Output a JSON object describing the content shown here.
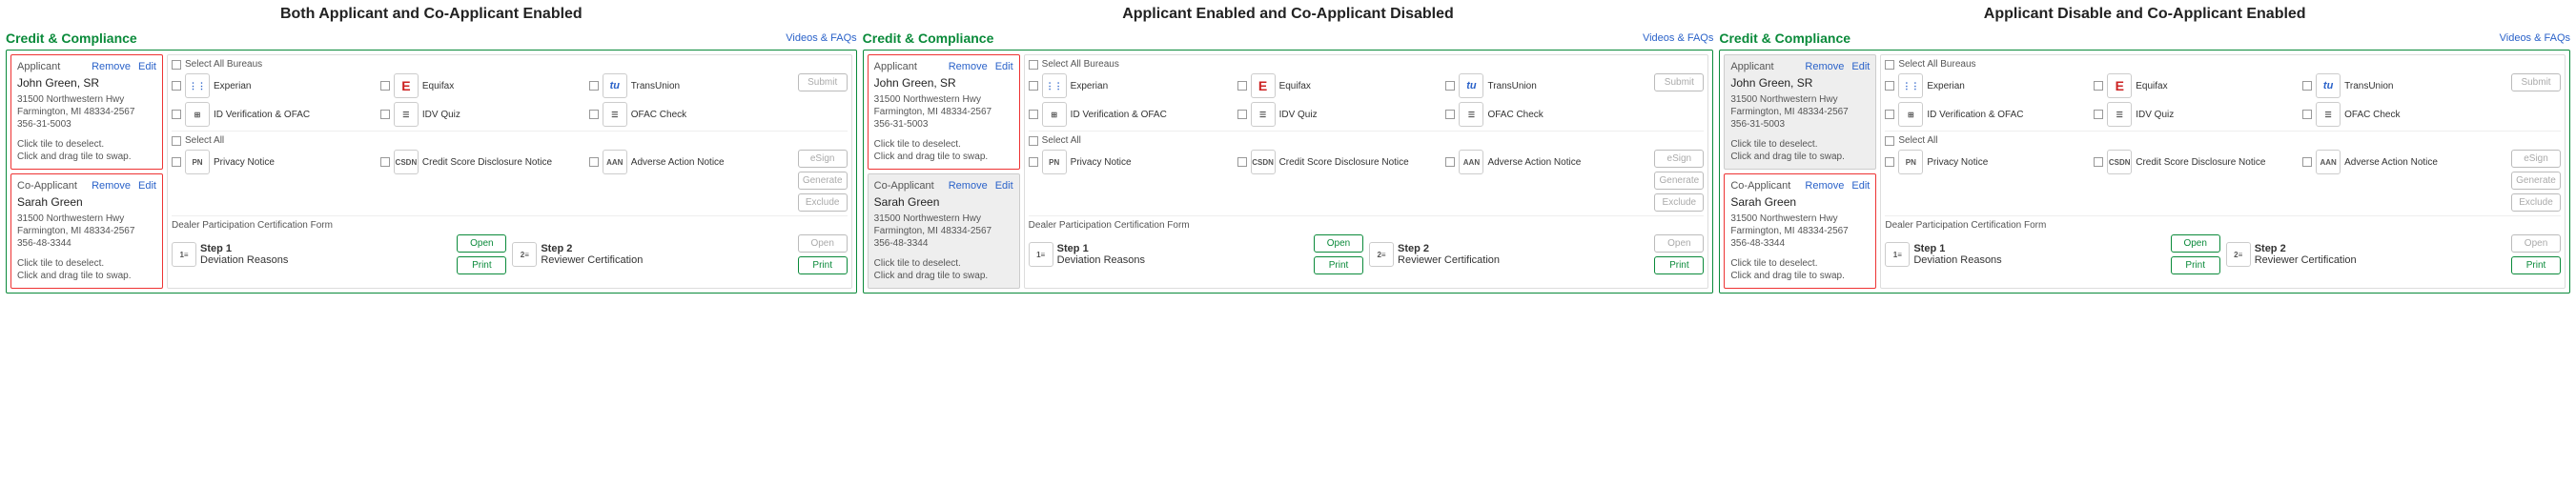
{
  "videos_faqs": "Videos & FAQs",
  "heading": "Credit & Compliance",
  "actions": {
    "remove": "Remove",
    "edit": "Edit"
  },
  "hint1": "Click tile to deselect.",
  "hint2": "Click and drag tile to swap.",
  "applicant": {
    "label": "Applicant",
    "name": "John Green, SR",
    "addr1": "31500 Northwestern Hwy",
    "addr2": "Farmington, MI 48334-2567",
    "phone": "356-31-5003"
  },
  "coapplicant": {
    "label": "Co-Applicant",
    "name": "Sarah Green",
    "addr1": "31500 Northwestern Hwy",
    "addr2": "Farmington, MI 48334-2567",
    "phone": "356-48-3344"
  },
  "sect1": {
    "hdr": "Select All Bureaus",
    "items": [
      "Experian",
      "Equifax",
      "TransUnion",
      "ID Verification & OFAC",
      "IDV Quiz",
      "OFAC Check"
    ]
  },
  "sect2": {
    "hdr": "Select All",
    "items": [
      "Privacy Notice",
      "Credit Score Disclosure Notice",
      "Adverse Action Notice"
    ]
  },
  "sect3": {
    "hdr": "Dealer Participation Certification Form",
    "step1": "Step 1",
    "step1s": "Deviation Reasons",
    "step2": "Step 2",
    "step2s": "Reviewer Certification"
  },
  "btns": {
    "submit": "Submit",
    "esign": "eSign",
    "generate": "Generate",
    "exclude": "Exclude",
    "open": "Open",
    "print": "Print"
  },
  "titles": {
    "a": "Both Applicant and Co-Applicant Enabled",
    "b": "Applicant Enabled and Co-Applicant Disabled",
    "c": "Applicant Disable and Co-Applicant Enabled"
  },
  "icons": {
    "exp": "⋮⋮",
    "eq": "E",
    "tu": "tu",
    "idv": "⊞",
    "quiz": "☰",
    "ofac": "☰",
    "pn": "PN",
    "csdn": "CSDN",
    "aan": "AAN",
    "d1": "1≡",
    "d2": "2≡"
  }
}
